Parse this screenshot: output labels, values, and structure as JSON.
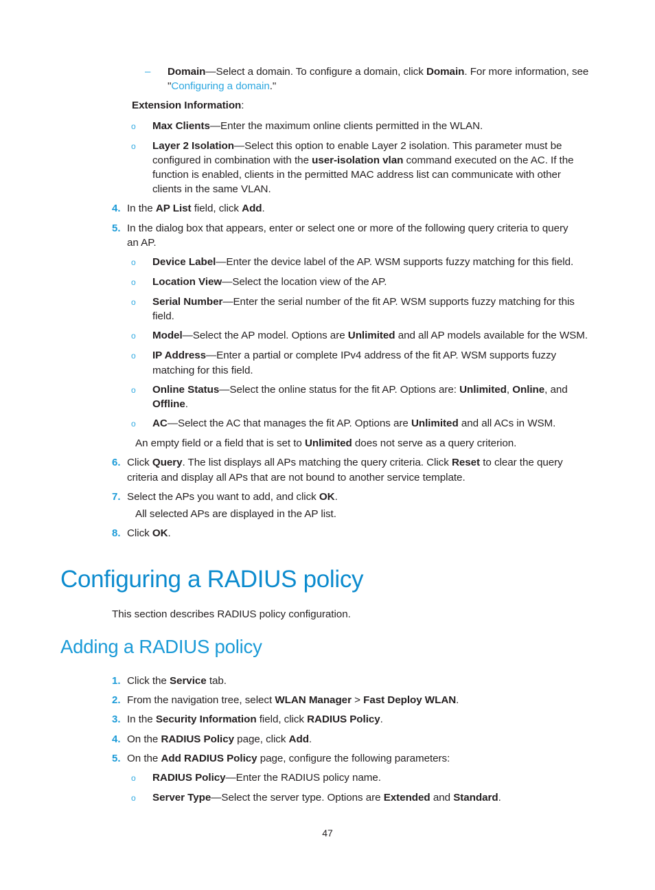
{
  "page": {
    "number": "47"
  },
  "markers": {
    "dash": "–",
    "circle": "o"
  },
  "top_section": {
    "dash_items": [
      {
        "term": "Domain",
        "sep": "—",
        "text_before_link": "Select a domain. To configure a domain, click ",
        "bold_inline": "Domain",
        "text_mid": ". For more information, see \"",
        "link": "Configuring a domain",
        "text_after": ".\""
      }
    ],
    "extension_label": "Extension Information",
    "extension_label_colon": ":",
    "extension_items": [
      {
        "term": "Max Clients",
        "sep": "—",
        "text": "Enter the maximum online clients permitted in the WLAN."
      },
      {
        "term": "Layer 2 Isolation",
        "sep": "—",
        "text_a": "Select this option to enable Layer 2 isolation. This parameter must be configured in combination with the ",
        "bold_inline": "user-isolation vlan",
        "text_b": " command executed on the AC. If the function is enabled, clients in the permitted MAC address list can communicate with other clients in the same VLAN."
      }
    ],
    "steps": [
      {
        "num": "4.",
        "text_a": "In the ",
        "bold_a": "AP List",
        "text_b": " field, click ",
        "bold_b": "Add",
        "text_c": "."
      },
      {
        "num": "5.",
        "text_a": "In the dialog box that appears, enter or select one or more of the following query criteria to query an AP."
      },
      {
        "num": "6.",
        "text_a": "Click ",
        "bold_a": "Query",
        "text_b": ". The list displays all APs matching the query criteria. Click ",
        "bold_b": "Reset",
        "text_c": " to clear the query criteria and display all APs that are not bound to another service template."
      },
      {
        "num": "7.",
        "text_a": "Select the APs you want to add, and click ",
        "bold_a": "OK",
        "text_b": "."
      },
      {
        "num": "8.",
        "text_a": "Click ",
        "bold_a": "OK",
        "text_b": "."
      }
    ],
    "query_criteria": [
      {
        "term": "Device Label",
        "sep": "—",
        "text": "Enter the device label of the AP. WSM supports fuzzy matching for this field."
      },
      {
        "term": "Location View",
        "sep": "—",
        "text": "Select the location view of the AP."
      },
      {
        "term": "Serial Number",
        "sep": "—",
        "text": "Enter the serial number of the fit AP. WSM supports fuzzy matching for this field."
      },
      {
        "term": "Model",
        "sep": "—",
        "text_a": "Select the AP model. Options are ",
        "bold_a": "Unlimited",
        "text_b": " and all AP models available for the WSM."
      },
      {
        "term": "IP Address",
        "sep": "—",
        "text": "Enter a partial or complete IPv4 address of the fit AP. WSM supports fuzzy matching for this field."
      },
      {
        "term": "Online Status",
        "sep": "—",
        "text_a": "Select the online status for the fit AP. Options are: ",
        "bold_a": "Unlimited",
        "text_b": ", ",
        "bold_b": "Online",
        "text_c": ", and ",
        "bold_c": "Offline",
        "text_d": "."
      },
      {
        "term": "AC",
        "sep": "—",
        "text_a": "Select the AC that manages the fit AP. Options are ",
        "bold_a": "Unlimited",
        "text_b": " and all ACs in WSM."
      }
    ],
    "empty_field_note": {
      "text_a": "An empty field or a field that is set to ",
      "bold_a": "Unlimited",
      "text_b": " does not serve as a query criterion."
    },
    "all_selected_note": "All selected APs are displayed in the AP list."
  },
  "headings": {
    "h1": "Configuring a RADIUS policy",
    "h1_body": "This section describes RADIUS policy configuration.",
    "h2": "Adding a RADIUS policy"
  },
  "bottom_section": {
    "steps": [
      {
        "num": "1.",
        "text_a": "Click the ",
        "bold_a": "Service",
        "text_b": " tab."
      },
      {
        "num": "2.",
        "text_a": "From the navigation tree, select ",
        "bold_a": "WLAN Manager",
        "text_b": " > ",
        "bold_b": "Fast Deploy WLAN",
        "text_c": "."
      },
      {
        "num": "3.",
        "text_a": "In the ",
        "bold_a": "Security Information",
        "text_b": " field, click ",
        "bold_b": "RADIUS Policy",
        "text_c": "."
      },
      {
        "num": "4.",
        "text_a": "On the ",
        "bold_a": "RADIUS Policy",
        "text_b": " page, click ",
        "bold_b": "Add",
        "text_c": "."
      },
      {
        "num": "5.",
        "text_a": "On the ",
        "bold_a": "Add RADIUS Policy",
        "text_b": " page, configure the following parameters:"
      }
    ],
    "params": [
      {
        "term": "RADIUS Policy",
        "sep": "—",
        "text": "Enter the RADIUS policy name."
      },
      {
        "term": "Server Type",
        "sep": "—",
        "text_a": "Select the server type. Options are ",
        "bold_a": "Extended",
        "text_b": " and ",
        "bold_b": "Standard",
        "text_c": "."
      }
    ]
  },
  "colors": {
    "heading_primary": "#0c8bce",
    "heading_secondary": "#1a9ad7",
    "link": "#2ca7e0",
    "bullet": "#2ca7e0",
    "number": "#1a9ad7",
    "body_text": "#231f20"
  }
}
